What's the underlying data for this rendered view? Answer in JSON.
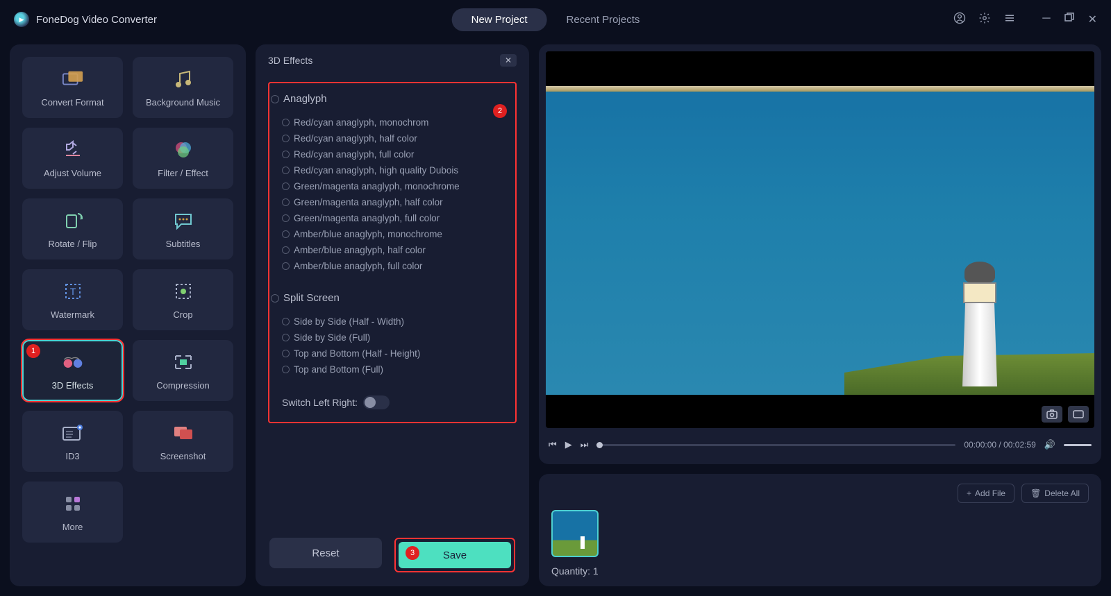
{
  "app": {
    "title": "FoneDog Video Converter"
  },
  "tabs": {
    "new": "New Project",
    "recent": "Recent Projects"
  },
  "sidebar": {
    "tools": [
      {
        "label": "Convert Format"
      },
      {
        "label": "Background Music"
      },
      {
        "label": "Adjust Volume"
      },
      {
        "label": "Filter / Effect"
      },
      {
        "label": "Rotate / Flip"
      },
      {
        "label": "Subtitles"
      },
      {
        "label": "Watermark"
      },
      {
        "label": "Crop"
      },
      {
        "label": "3D Effects"
      },
      {
        "label": "Compression"
      },
      {
        "label": "ID3"
      },
      {
        "label": "Screenshot"
      },
      {
        "label": "More"
      }
    ]
  },
  "panel": {
    "title": "3D Effects",
    "section_anaglyph": "Anaglyph",
    "anaglyph_options": [
      "Red/cyan anaglyph, monochrom",
      "Red/cyan anaglyph, half color",
      "Red/cyan anaglyph, full color",
      "Red/cyan anaglyph, high quality Dubois",
      "Green/magenta anaglyph, monochrome",
      "Green/magenta anaglyph, half color",
      "Green/magenta anaglyph, full color",
      "Amber/blue anaglyph, monochrome",
      "Amber/blue anaglyph, half color",
      "Amber/blue anaglyph, full color"
    ],
    "section_split": "Split Screen",
    "split_options": [
      "Side by Side (Half - Width)",
      "Side by Side (Full)",
      "Top and Bottom (Half - Height)",
      "Top and Bottom (Full)"
    ],
    "switch_label": "Switch Left Right:",
    "reset": "Reset",
    "save": "Save"
  },
  "markers": {
    "m1": "1",
    "m2": "2",
    "m3": "3"
  },
  "player": {
    "time": "00:00:00 / 00:02:59"
  },
  "filelist": {
    "add": "Add File",
    "delete": "Delete All",
    "quantity_label": "Quantity:",
    "quantity_value": "1"
  }
}
